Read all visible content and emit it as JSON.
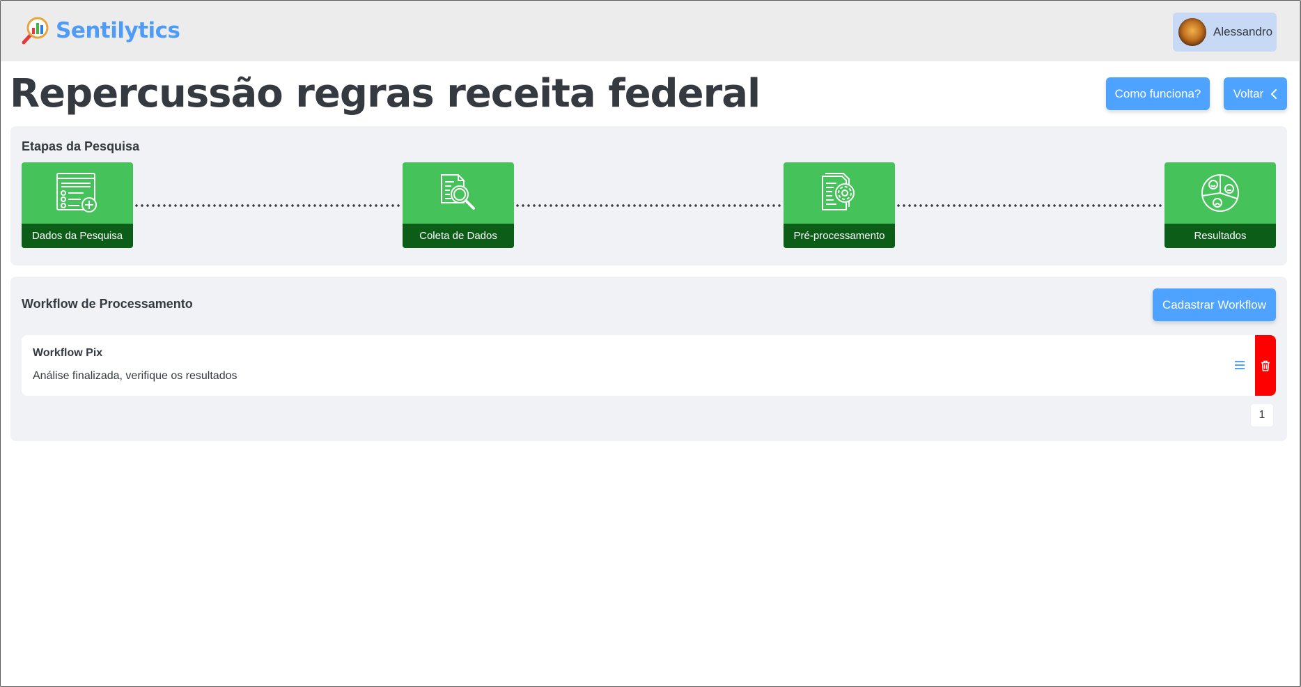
{
  "header": {
    "brand_name": "Sentilytics",
    "user_name": "Alessandro"
  },
  "page": {
    "title": "Repercussão regras receita federal",
    "how_it_works_label": "Como funciona?",
    "back_label": "Voltar"
  },
  "steps": {
    "heading": "Etapas da Pesquisa",
    "items": [
      {
        "label": "Dados da Pesquisa",
        "icon": "form-add-icon"
      },
      {
        "label": "Coleta de Dados",
        "icon": "document-search-icon"
      },
      {
        "label": "Pré-processamento",
        "icon": "document-gear-icon"
      },
      {
        "label": "Resultados",
        "icon": "sentiment-pie-icon"
      }
    ]
  },
  "workflow": {
    "heading": "Workflow de Processamento",
    "register_label": "Cadastrar Workflow",
    "items": [
      {
        "name": "Workflow Pix",
        "status": "Análise finalizada, verifique os resultados"
      }
    ],
    "pagination": {
      "current_page": "1"
    }
  },
  "colors": {
    "brand_blue": "#4e9cf7",
    "button_blue": "#4da3ff",
    "step_green": "#45c25a",
    "step_label_green": "#0b5d17",
    "delete_red": "#ff0000",
    "card_bg": "#f0f2f6"
  }
}
